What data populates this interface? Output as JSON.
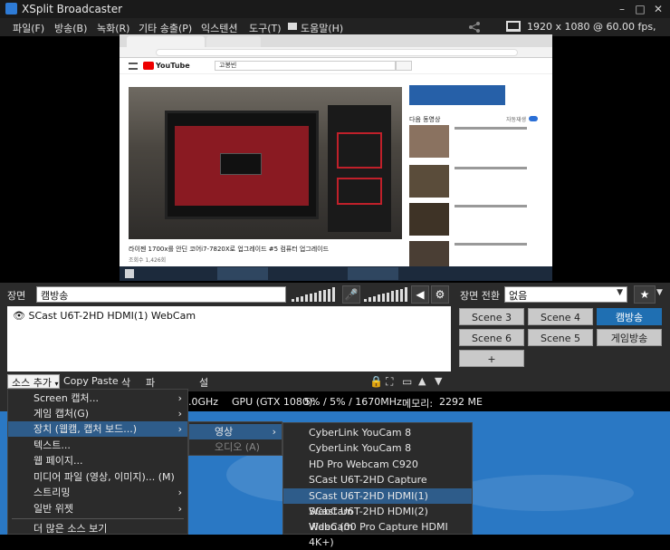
{
  "titlebar": {
    "title": "XSplit Broadcaster"
  },
  "menubar": {
    "items": [
      "파일(F)",
      "방송(B)",
      "녹화(R)",
      "기타 송출(P)",
      "익스텐션",
      "도구(T)",
      "도움말(H)"
    ],
    "resolution": "1920 x 1080 @ 60.00 fps, 31%"
  },
  "preview": {
    "video_caption": "라이젠 1700x를 안딘 코어i7-7820X로 업그레이드 #5 컴퓨터 업그레이드",
    "views": "조회수 1,426회",
    "yt_search": "고봉빈",
    "next_label": "다음 동영상",
    "autoplay_label": "자동재생"
  },
  "scene_bar": {
    "label": "장면",
    "scene_name": "캠방송",
    "transition_label": "장면 전환",
    "transition_value": "없음"
  },
  "sources": {
    "items": [
      {
        "name": "SCast U6T-2HD HDMI(1) WebCam"
      }
    ]
  },
  "source_toolbar": {
    "add": "소스 추가",
    "copy": "Copy",
    "paste": "Paste",
    "delete": "삭제",
    "rename": "파일명 변경",
    "settings": "설정"
  },
  "scenes": {
    "row1": [
      "Scene 3",
      "Scene 4",
      "캠방송"
    ],
    "row2": [
      "Scene 6",
      "Scene 5",
      "게임방송"
    ],
    "add": "+"
  },
  "status": {
    "cpu": ".0GHz",
    "gpu": "GPU (GTX 1080):",
    "gpu_value": "5% / 5% / 1670MHz",
    "memory_label": "메모리:",
    "memory_value": "2292 ME"
  },
  "menu_main": {
    "items": [
      "Screen 캡처...",
      "게임 캡처(G)",
      "장치 (웹캠, 캡처 보드...)",
      "텍스트...",
      "웹 페이지...",
      "미디어 파일 (영상, 이미지)... (M)",
      "스트리밍",
      "일반 위젯",
      "더 많은 소스 보기"
    ]
  },
  "menu_device": {
    "items": [
      "영상",
      "오디오 (A)"
    ]
  },
  "menu_video": {
    "items": [
      "CyberLink YouCam 8",
      "CyberLink YouCam 8",
      "HD Pro Webcam C920",
      "SCast U6T-2HD Capture",
      "SCast U6T-2HD HDMI(1) WebCam",
      "SCast U6T-2HD HDMI(2) WebCam",
      "Video (00 Pro Capture HDMI 4K+)"
    ]
  },
  "colors": {
    "accent": "#1f6fb2",
    "menu_highlight": "#2e5c8a"
  }
}
